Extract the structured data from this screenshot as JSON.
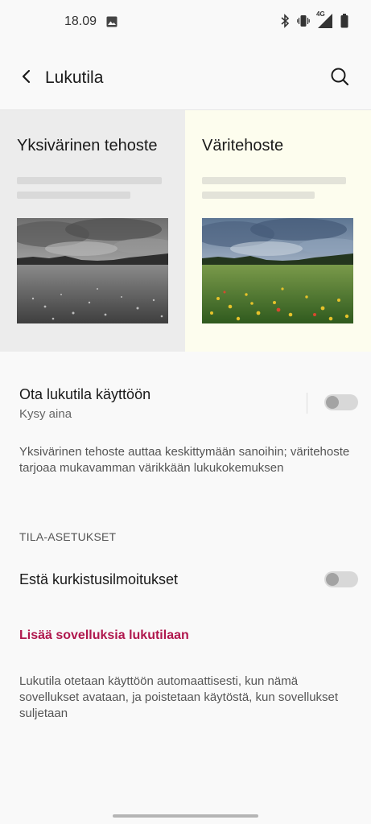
{
  "status_bar": {
    "time": "18.09",
    "network_label": "4G",
    "icons": [
      "gallery-icon",
      "bluetooth-icon",
      "vibrate-icon",
      "signal-icon",
      "battery-icon"
    ]
  },
  "app_bar": {
    "title": "Lukutila",
    "back_icon": "back-arrow-icon",
    "search_icon": "search-icon"
  },
  "preview": {
    "mono": {
      "title": "Yksivärinen tehoste"
    },
    "color": {
      "title": "Väritehoste"
    }
  },
  "settings": {
    "enable_title": "Ota lukutila käyttöön",
    "enable_subtitle": "Kysy aina",
    "enable_on": false,
    "description": "Yksivärinen tehoste auttaa keskittymään sanoihin; väritehoste tarjoaa mukavamman värikkään lukukokemuksen",
    "section_header": "TILA-ASETUKSET",
    "block_peek_title": "Estä kurkistusilmoitukset",
    "block_peek_on": false,
    "add_apps_link": "Lisää sovelluksia lukutilaan",
    "footer_note": "Lukutila otetaan käyttöön automaattisesti, kun nämä sovellukset avataan, ja poistetaan käytöstä, kun sovellukset suljetaan"
  },
  "colors": {
    "accent": "#b0174d",
    "background": "#f9f9f9",
    "mono_panel": "#ececec",
    "color_panel": "#fdfdee"
  }
}
